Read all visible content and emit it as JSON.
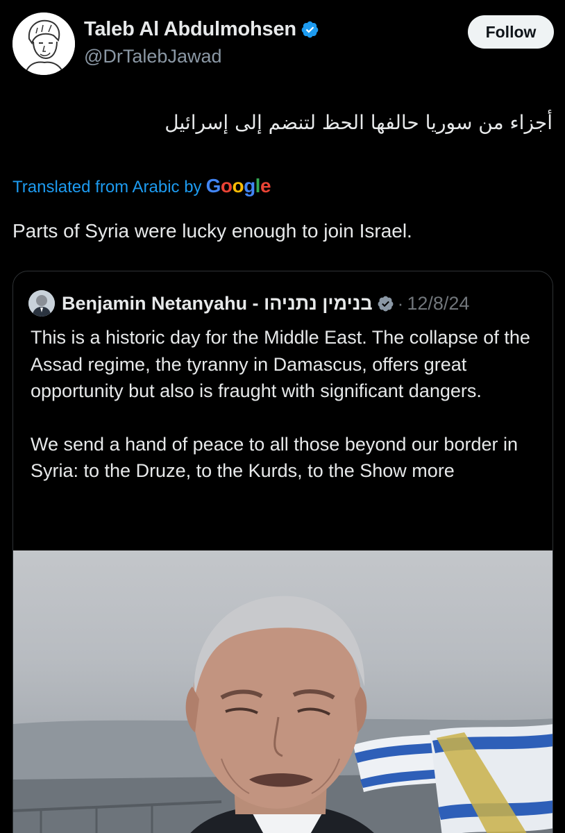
{
  "author": {
    "display_name": "Taleb Al Abdulmohsen",
    "handle": "@DrTalebJawad",
    "verified": true
  },
  "follow_label": "Follow",
  "tweet": {
    "original_text": "أجزاء من سوريا حالفها الحظ لتنضم إلى إسرائيل",
    "translated_label": "Translated from Arabic by",
    "translator_brand": "Google",
    "translation": "Parts of Syria were lucky enough to join Israel."
  },
  "quoted_tweet": {
    "name": "Benjamin Netanyahu - בנימין נתניהו",
    "verified": true,
    "separator": "·",
    "date": "12/8/24",
    "paragraph_1": "This is a historic day for the Middle East. The collapse of the Assad regime, the tyranny in Damascus, offers great opportunity but also is fraught with significant dangers.",
    "paragraph_2": "We send a hand of peace to all those beyond our border in Syria: to the Druze, to the Kurds, to the",
    "show_more": "Show more"
  },
  "colors": {
    "background": "#000000",
    "text": "#e7e9ea",
    "muted": "#8b98a5",
    "link": "#1d9bf0",
    "verified_badge": "#1d9bf0",
    "border": "#2f3336"
  }
}
